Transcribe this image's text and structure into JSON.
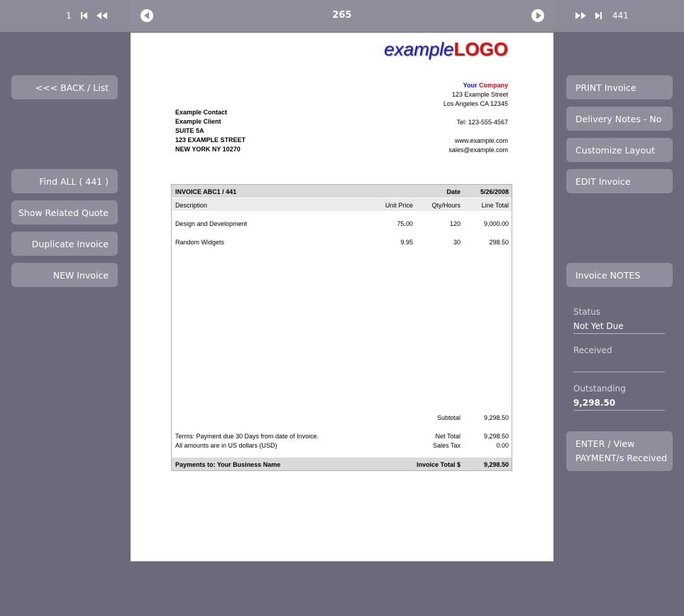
{
  "nav": {
    "first_number": "1",
    "record_number": "265",
    "total_records": "441"
  },
  "left_buttons": {
    "back": "<<<   BACK / List",
    "find_all": "Find ALL  ( 441 )",
    "show_related_quote": "Show Related Quote",
    "duplicate": "Duplicate Invoice",
    "new_invoice": "NEW Invoice"
  },
  "right_buttons": {
    "print": "PRINT Invoice",
    "delivery_notes": "Delivery Notes - No",
    "customize_layout": "Customize Layout",
    "edit": "EDIT Invoice",
    "notes": "Invoice NOTES",
    "enter_payment": "ENTER / View\nPAYMENT/s Received"
  },
  "fields": {
    "status_label": "Status",
    "status_value": "Not Yet Due",
    "received_label": "Received",
    "received_value": "",
    "outstanding_label": "Outstanding",
    "outstanding_value": "9,298.50"
  },
  "invoice": {
    "logo_a": "example",
    "logo_b": "LOGO",
    "company_your": "Your",
    "company_name": "Company",
    "company_street": "123 Example Street",
    "company_city": "Los Angeles CA  12345",
    "company_tel": "Tel: 123-555-4567",
    "company_web": "www.example.com",
    "company_email": "sales@example.com",
    "client_contact": "Example Contact",
    "client_name": "Example Client",
    "client_suite": "SUITE 5A",
    "client_street": "123 EXAMPLE STREET",
    "client_city": "NEW YORK NY  10270",
    "number": "INVOICE  ABC1 / 441",
    "date_label": "Date",
    "date": "5/26/2008",
    "columns": {
      "description": "Description",
      "unit_price": "Unit Price",
      "qty": "Qty/Hours",
      "line_total": "Line Total"
    },
    "items": [
      {
        "description": "Design and Development",
        "unit_price": "75.00",
        "qty": "120",
        "line_total": "9,000.00"
      },
      {
        "description": "Random Widgets",
        "unit_price": "9.95",
        "qty": "30",
        "line_total": "298.50"
      }
    ],
    "subtotal_label": "Subtotal",
    "subtotal": "9,298.50",
    "terms_1": "Terms: Payment due 30 Days from date of Invoice.",
    "terms_2": "All amounts are in US dollars (USD)",
    "net_total_label": "Net Total",
    "net_total": "9,298.50",
    "sales_tax_label": "Sales Tax",
    "sales_tax": "0.00",
    "payments_to": "Payments to: Your Business Name",
    "invoice_total_label": "Invoice Total  $",
    "invoice_total": "9,298.50"
  }
}
